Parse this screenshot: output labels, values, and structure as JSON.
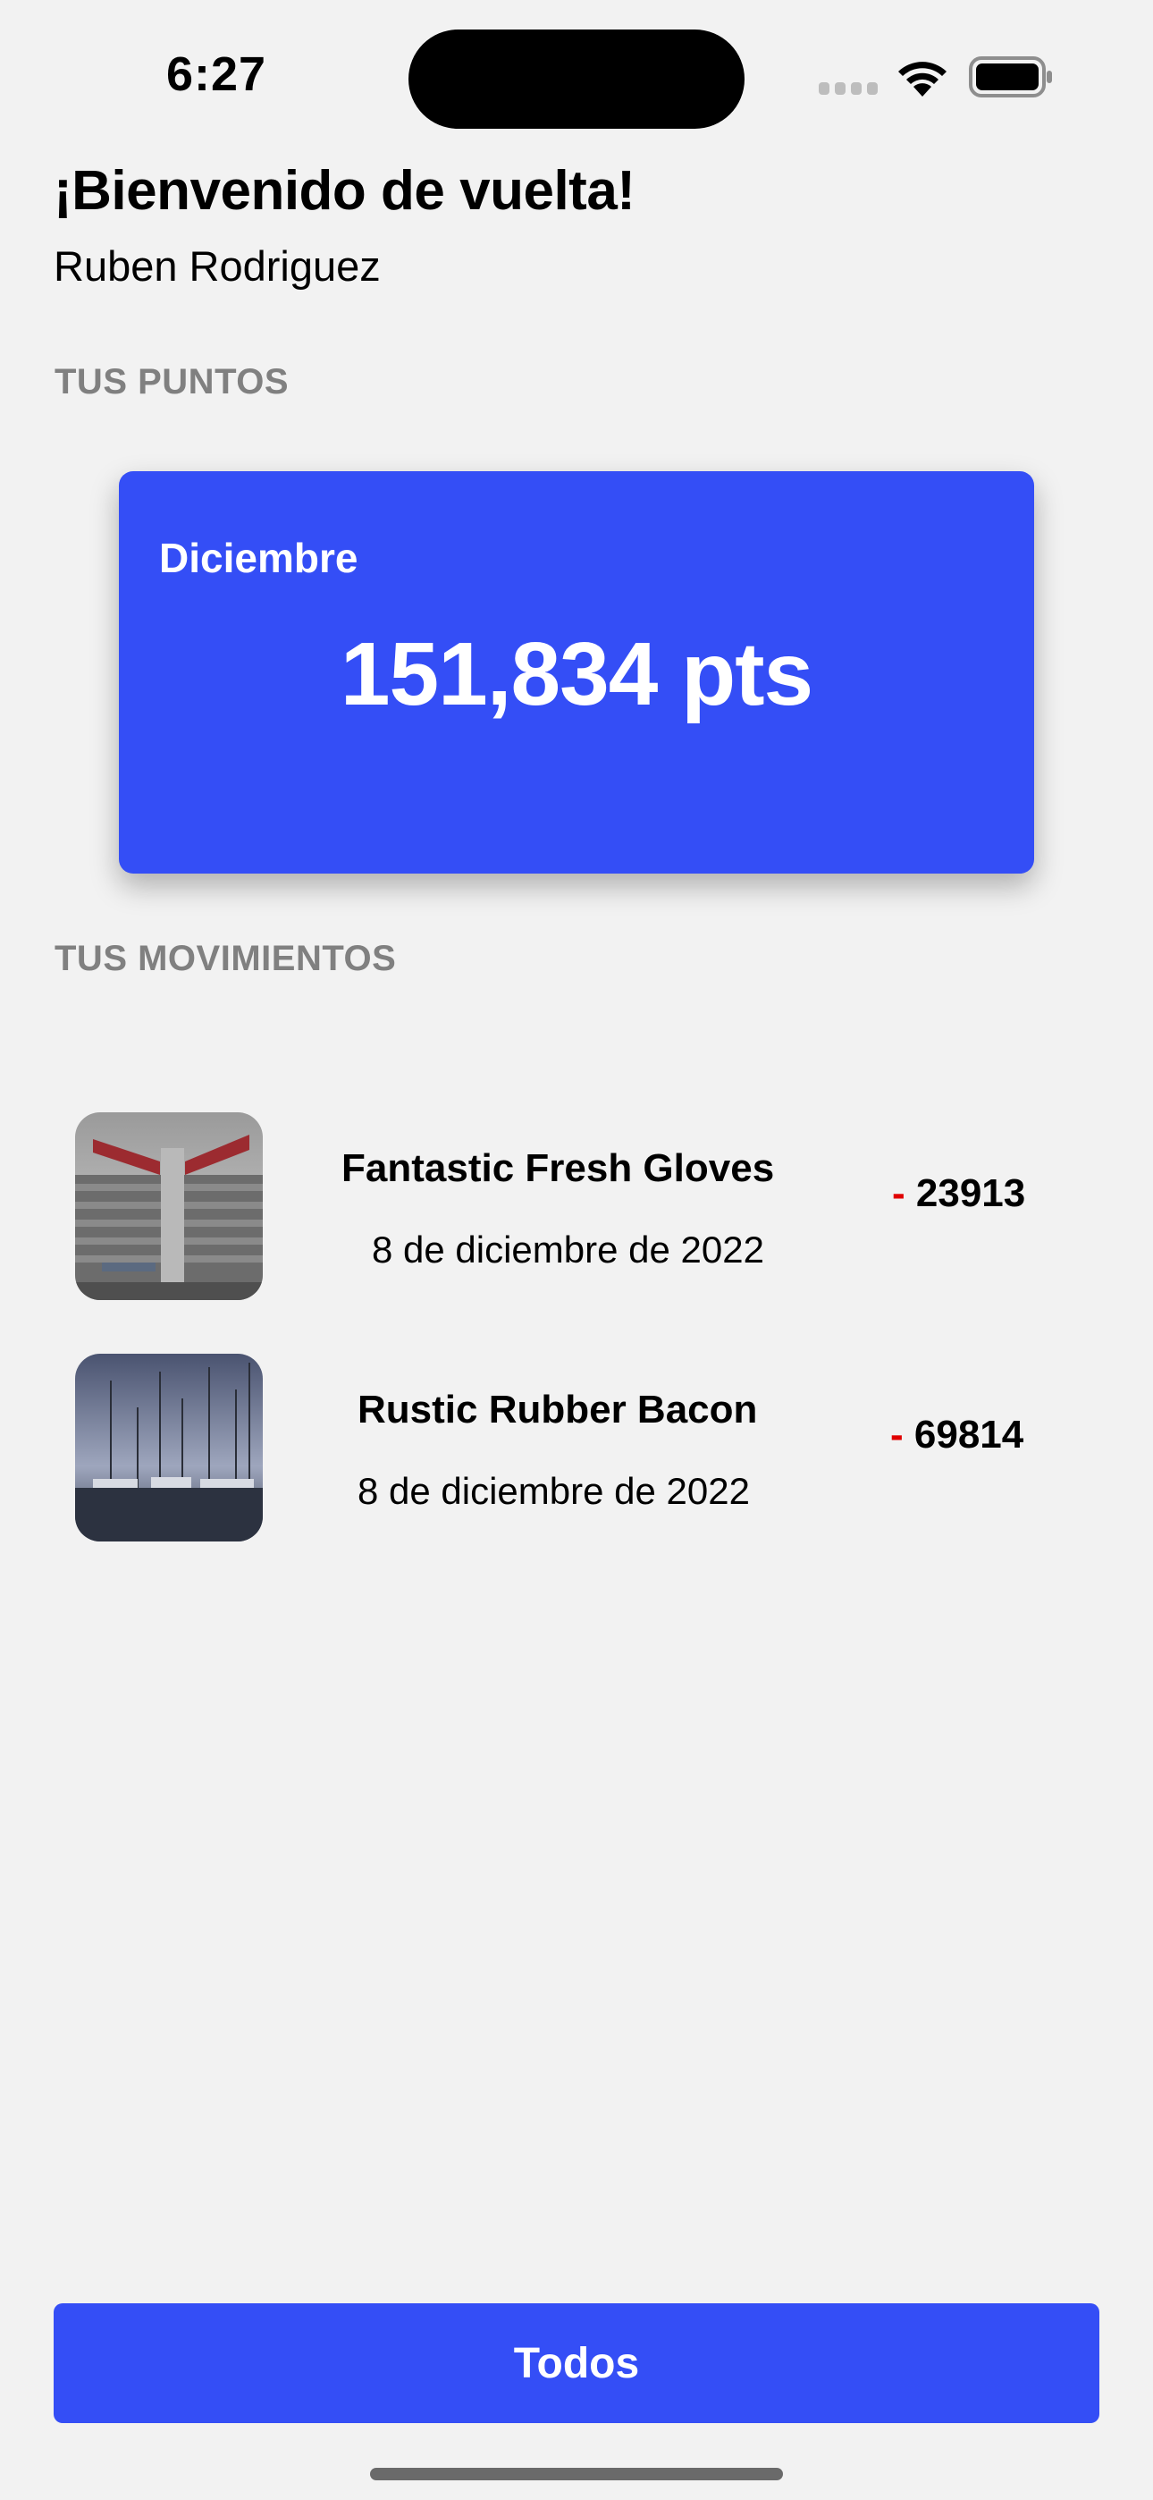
{
  "status_bar": {
    "time": "6:27",
    "icons": [
      "signal-icon",
      "wifi-icon",
      "battery-icon"
    ]
  },
  "header": {
    "greeting": "¡Bienvenido de vuelta!",
    "user_name": "Ruben Rodriguez"
  },
  "points": {
    "section_label": "TUS PUNTOS",
    "month": "Diciembre",
    "total": "151,834 pts"
  },
  "movements": {
    "section_label": "TUS MOVIMIENTOS",
    "items": [
      {
        "title": "Fantastic Fresh Gloves",
        "date": "8 de diciembre de 2022",
        "sign": "-",
        "amount": "23913",
        "thumbnail": "stadium-photo"
      },
      {
        "title": "Rustic Rubber Bacon",
        "date": "8 de diciembre de 2022",
        "sign": "-",
        "amount": "69814",
        "thumbnail": "marina-photo"
      }
    ]
  },
  "actions": {
    "all_label": "Todos"
  },
  "colors": {
    "accent": "#344ef6",
    "background": "#f2f2f2",
    "negative": "#e00000",
    "section_label": "#808080"
  }
}
